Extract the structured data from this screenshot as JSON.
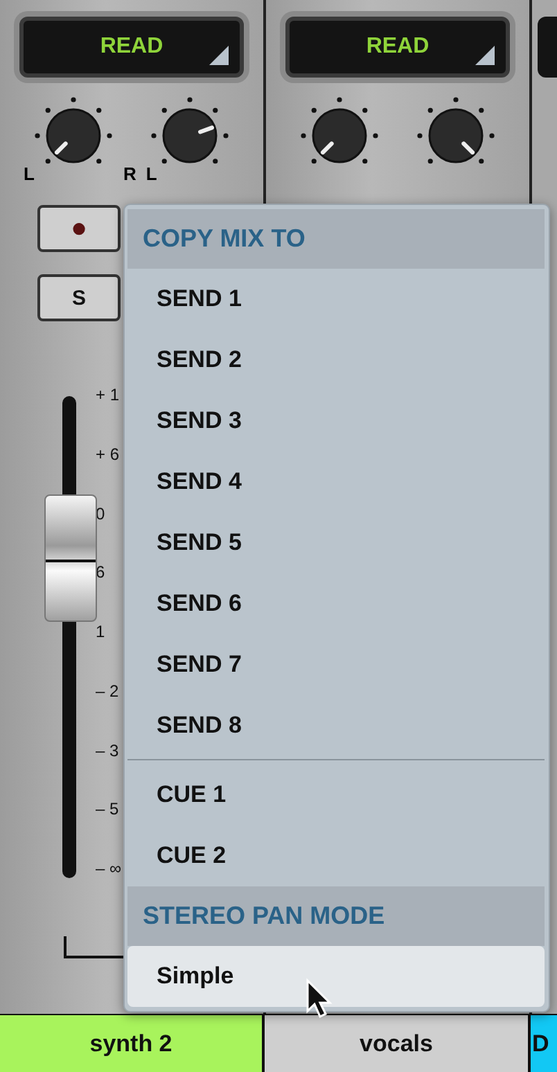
{
  "channels": [
    {
      "automation": "READ",
      "pan_labels": [
        "L",
        "R",
        "L"
      ],
      "record": "●",
      "solo": "S",
      "fader": {
        "scale": [
          "+ 1",
          "+ 6",
          "0",
          "6",
          "1",
          "– 2",
          "– 3",
          "– 5",
          "– ∞"
        ]
      }
    },
    {
      "automation": "READ"
    }
  ],
  "menu": [
    {
      "kind": "header",
      "label": "COPY MIX TO"
    },
    {
      "kind": "item",
      "label": "SEND 1",
      "selected": false
    },
    {
      "kind": "item",
      "label": "SEND 2",
      "selected": false
    },
    {
      "kind": "item",
      "label": "SEND 3",
      "selected": false
    },
    {
      "kind": "item",
      "label": "SEND 4",
      "selected": false
    },
    {
      "kind": "item",
      "label": "SEND 5",
      "selected": false
    },
    {
      "kind": "item",
      "label": "SEND 6",
      "selected": false
    },
    {
      "kind": "item",
      "label": "SEND 7",
      "selected": false
    },
    {
      "kind": "item",
      "label": "SEND 8",
      "selected": false
    },
    {
      "kind": "divider"
    },
    {
      "kind": "item",
      "label": "CUE 1",
      "selected": false
    },
    {
      "kind": "item",
      "label": "CUE 2",
      "selected": false
    },
    {
      "kind": "header",
      "label": "STEREO PAN MODE"
    },
    {
      "kind": "option",
      "label": "Simple",
      "selected": true
    }
  ],
  "track_tabs": [
    {
      "label": "synth 2",
      "color": "#a8f35c"
    },
    {
      "label": "vocals",
      "color": "#cfcfcf"
    },
    {
      "label": "D",
      "color": "#12c8f4"
    }
  ]
}
